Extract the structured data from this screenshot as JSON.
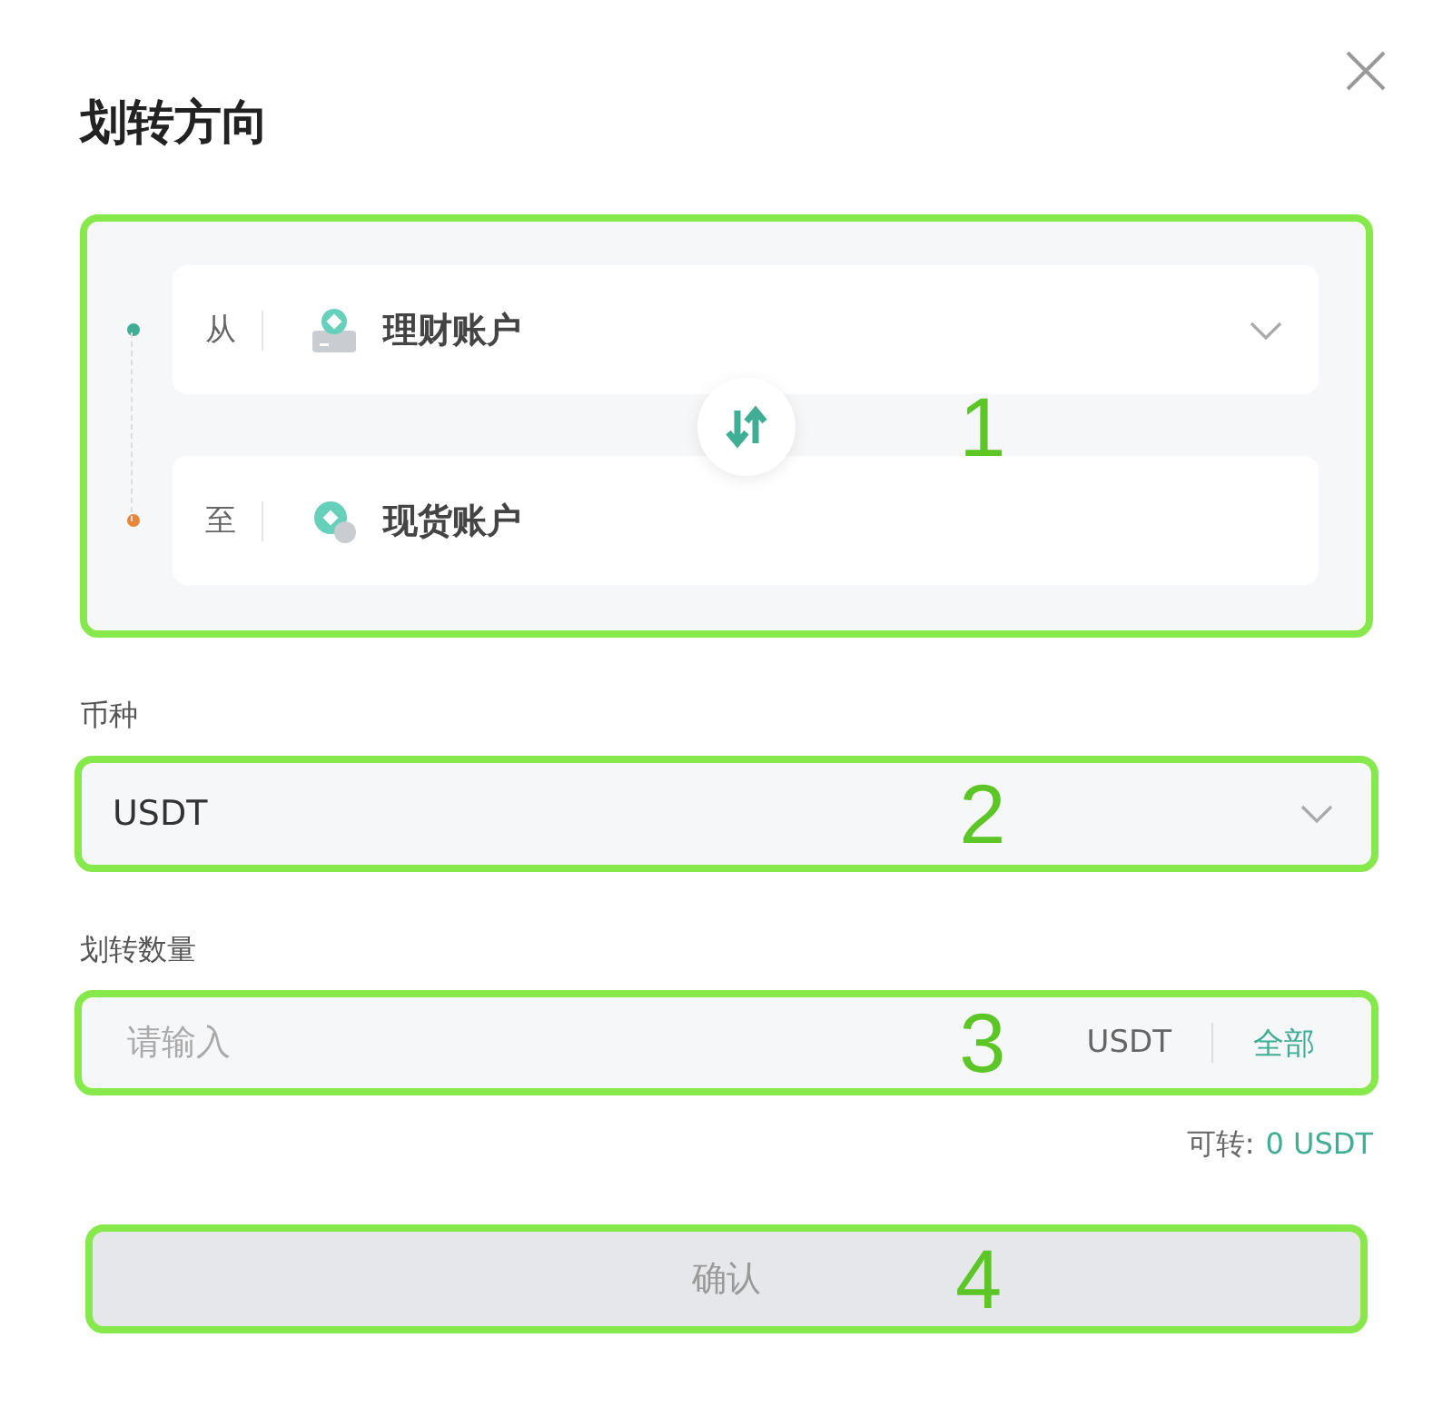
{
  "dialog": {
    "title": "划转方向"
  },
  "direction": {
    "annotation": "1",
    "accounts": [
      {
        "kind": "from",
        "label": "从",
        "account": "理财账户",
        "color": "#3fae95",
        "dropdown": true
      },
      {
        "kind": "to",
        "label": "至",
        "account": "现货账户",
        "color": "#e8873a",
        "dropdown": false
      }
    ]
  },
  "currency": {
    "label": "币种",
    "value": "USDT",
    "annotation": "2"
  },
  "amount": {
    "label": "划转数量",
    "placeholder": "请输入",
    "unit": "USDT",
    "all": "全部",
    "annotation": "3"
  },
  "available": {
    "label": "可转:",
    "value": "0 USDT"
  },
  "confirm": {
    "label": "确认",
    "disabled": true,
    "annotation": "4"
  }
}
